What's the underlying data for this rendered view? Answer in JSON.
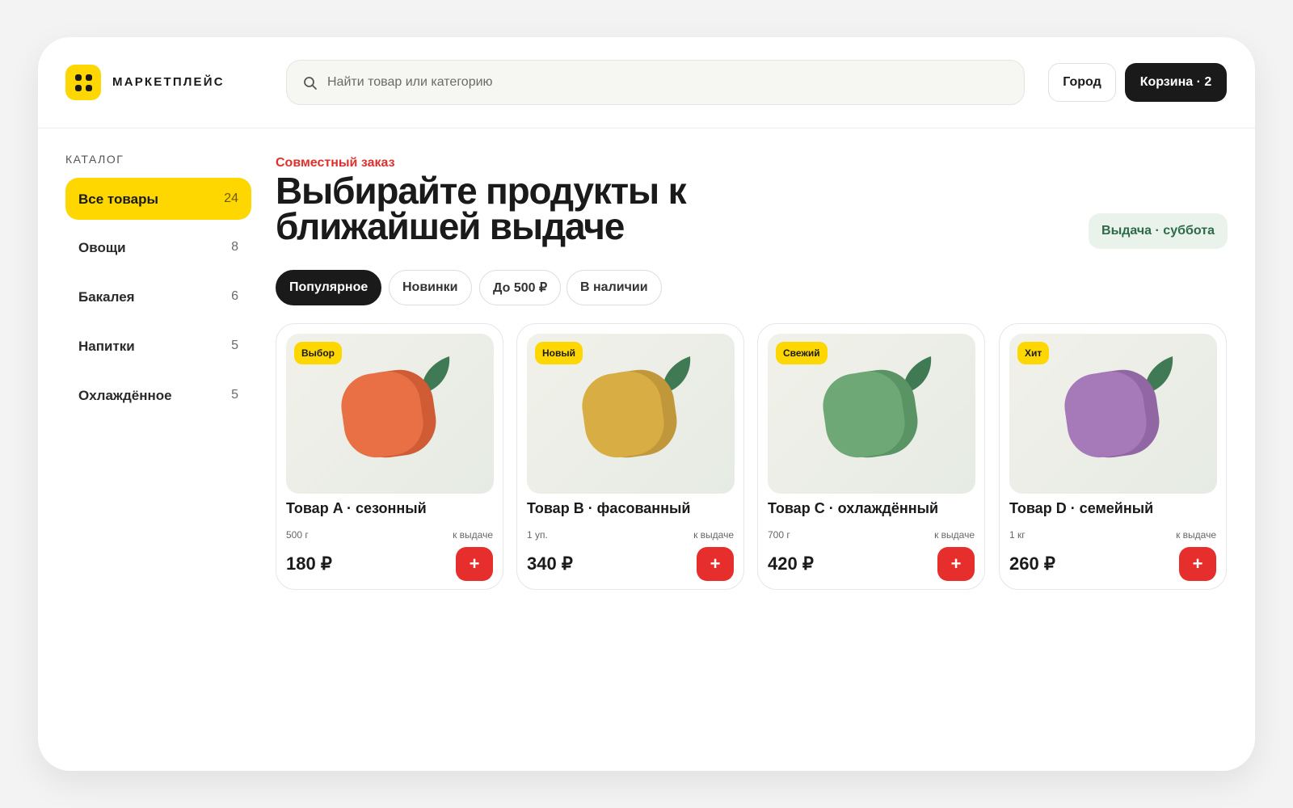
{
  "header": {
    "brand": "МАРКЕТПЛЕЙС",
    "search_placeholder": "Найти товар или категорию",
    "city_label": "Город",
    "cart_label": "Корзина · 2"
  },
  "sidebar": {
    "title": "КАТАЛОГ",
    "items": [
      {
        "label": "Все товары",
        "count": "24"
      },
      {
        "label": "Овощи",
        "count": "8"
      },
      {
        "label": "Бакалея",
        "count": "6"
      },
      {
        "label": "Напитки",
        "count": "5"
      },
      {
        "label": "Охлаждённое",
        "count": "5"
      }
    ]
  },
  "main": {
    "eyebrow": "Совместный заказ",
    "headline": "Выбирайте продукты к ближайшей выдаче",
    "pickup_badge": "Выдача · суббота",
    "filters": [
      {
        "label": "Популярное"
      },
      {
        "label": "Новинки"
      },
      {
        "label": "До 500 ₽"
      },
      {
        "label": "В наличии"
      }
    ]
  },
  "products": [
    {
      "badge": "Выбор",
      "name": "Товар A · сезонный",
      "unit": "500 г",
      "availability": "к выдаче",
      "price": "180 ₽",
      "add_label": "+",
      "fruit_color": "#e96f45",
      "fruit_shade": "#d05c36"
    },
    {
      "badge": "Новый",
      "name": "Товар B · фасованный",
      "unit": "1 уп.",
      "availability": "к выдаче",
      "price": "340 ₽",
      "add_label": "+",
      "fruit_color": "#d8ad43",
      "fruit_shade": "#c0973a"
    },
    {
      "badge": "Свежий",
      "name": "Товар C · охлаждённый",
      "unit": "700 г",
      "availability": "к выдаче",
      "price": "420 ₽",
      "add_label": "+",
      "fruit_color": "#6ea877",
      "fruit_shade": "#5a9464"
    },
    {
      "badge": "Хит",
      "name": "Товар D · семейный",
      "unit": "1 кг",
      "availability": "к выдаче",
      "price": "260 ₽",
      "add_label": "+",
      "fruit_color": "#a67ab8",
      "fruit_shade": "#9067a3"
    }
  ],
  "colors": {
    "accent_yellow": "#fed700",
    "accent_red": "#e62e2d",
    "leaf": "#3f7a55"
  }
}
